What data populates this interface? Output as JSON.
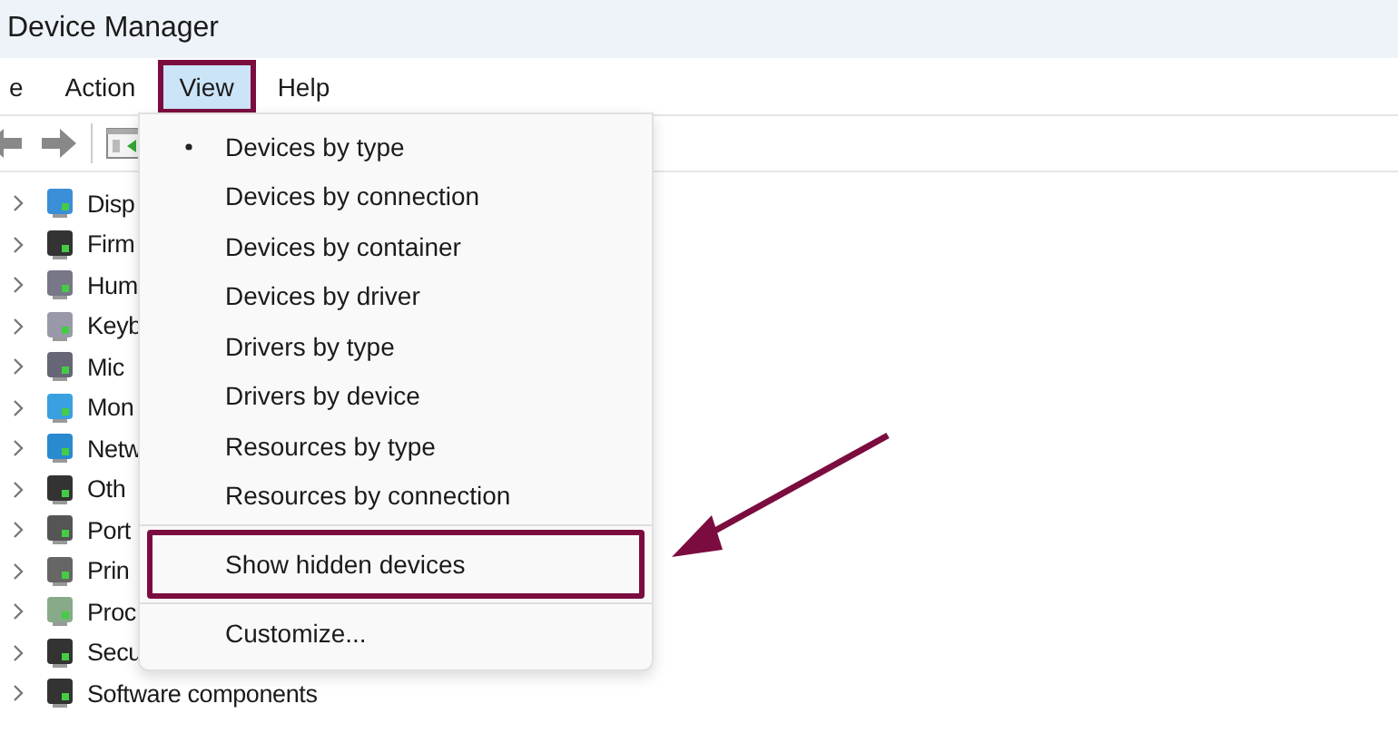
{
  "window": {
    "title": "Device Manager"
  },
  "menubar": [
    {
      "label": "e",
      "selected": false,
      "annotated": false
    },
    {
      "label": "Action",
      "selected": false,
      "annotated": false
    },
    {
      "label": "View",
      "selected": true,
      "annotated": true
    },
    {
      "label": "Help",
      "selected": false,
      "annotated": false
    }
  ],
  "tree": [
    {
      "label": "Disp"
    },
    {
      "label": "Firm"
    },
    {
      "label": "Hum"
    },
    {
      "label": "Keyb"
    },
    {
      "label": "Mic"
    },
    {
      "label": "Mon"
    },
    {
      "label": "Netw"
    },
    {
      "label": "Oth"
    },
    {
      "label": "Port"
    },
    {
      "label": "Prin"
    },
    {
      "label": "Proc"
    },
    {
      "label": "Secu"
    },
    {
      "label": "Software components"
    }
  ],
  "view_menu": [
    {
      "kind": "item",
      "label": "Devices by type",
      "selected": true,
      "annotated": false
    },
    {
      "kind": "item",
      "label": "Devices by connection",
      "selected": false,
      "annotated": false
    },
    {
      "kind": "item",
      "label": "Devices by container",
      "selected": false,
      "annotated": false
    },
    {
      "kind": "item",
      "label": "Devices by driver",
      "selected": false,
      "annotated": false
    },
    {
      "kind": "item",
      "label": "Drivers by type",
      "selected": false,
      "annotated": false
    },
    {
      "kind": "item",
      "label": "Drivers by device",
      "selected": false,
      "annotated": false
    },
    {
      "kind": "item",
      "label": "Resources by type",
      "selected": false,
      "annotated": false
    },
    {
      "kind": "item",
      "label": "Resources by connection",
      "selected": false,
      "annotated": false
    },
    {
      "kind": "separator"
    },
    {
      "kind": "item",
      "label": "Show hidden devices",
      "selected": false,
      "annotated": true
    },
    {
      "kind": "separator"
    },
    {
      "kind": "item",
      "label": "Customize...",
      "selected": false,
      "annotated": false
    }
  ],
  "annotation_arrow": true
}
